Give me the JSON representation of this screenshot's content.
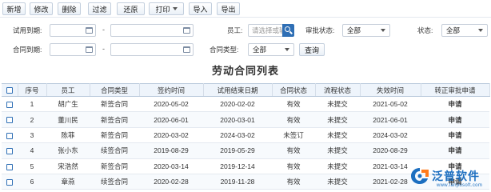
{
  "toolbar": {
    "new": "新增",
    "edit": "修改",
    "delete": "删除",
    "filter": "过滤",
    "restore": "还原",
    "print": "打印",
    "import": "导入",
    "export": "导出"
  },
  "filters": {
    "probation_end_label": "试用到期:",
    "contract_end_label": "合同到期:",
    "range_dash": "-",
    "employee_label": "员工:",
    "employee_placeholder": "请选择或输入",
    "approval_status_label": "审批状态:",
    "approval_status_value": "全部",
    "status_label": "状态:",
    "status_value": "全部",
    "contract_type_label": "合同类型:",
    "contract_type_value": "全部",
    "query": "查询"
  },
  "list": {
    "title": "劳动合同列表",
    "columns": [
      "",
      "序号",
      "员工",
      "合同类型",
      "签约时间",
      "试用结束日期",
      "合同状态",
      "流程状态",
      "失效时间",
      "转正审批申请"
    ],
    "rows": [
      {
        "no": "1",
        "employee": "胡广生",
        "type": "新签合同",
        "signed": "2020-05-02",
        "probation_end": "2020-02-02",
        "contract_status": "有效",
        "flow_status": "未提交",
        "expire": "2021-05-02",
        "action": "申请"
      },
      {
        "no": "2",
        "employee": "董川民",
        "type": "新签合同",
        "signed": "2020-06-01",
        "probation_end": "2020-03-01",
        "contract_status": "有效",
        "flow_status": "未提交",
        "expire": "2021-06-01",
        "action": "申请"
      },
      {
        "no": "3",
        "employee": "陈菲",
        "type": "新签合同",
        "signed": "2020-03-02",
        "probation_end": "2024-03-02",
        "contract_status": "未签订",
        "flow_status": "未提交",
        "expire": "2024-03-02",
        "action": "申请"
      },
      {
        "no": "4",
        "employee": "张小东",
        "type": "续签合同",
        "signed": "2019-08-29",
        "probation_end": "2019-05-29",
        "contract_status": "有效",
        "flow_status": "未提交",
        "expire": "2020-08-29",
        "action": "申请"
      },
      {
        "no": "5",
        "employee": "宋浩然",
        "type": "新签合同",
        "signed": "2020-03-14",
        "probation_end": "2019-12-14",
        "contract_status": "有效",
        "flow_status": "未提交",
        "expire": "2021-03-14",
        "action": "申请"
      },
      {
        "no": "6",
        "employee": "章燕",
        "type": "续签合同",
        "signed": "2020-02-28",
        "probation_end": "2019-11-28",
        "contract_status": "有效",
        "flow_status": "未提交",
        "expire": "2021-02-28",
        "action": "申请"
      }
    ]
  },
  "logo": {
    "name": "泛普软件",
    "url_text": "www.fanpusoft.com"
  },
  "colors": {
    "accent": "#2f6fb5",
    "header_bg": "#eef4fb",
    "logo": "#1d6fc0"
  }
}
